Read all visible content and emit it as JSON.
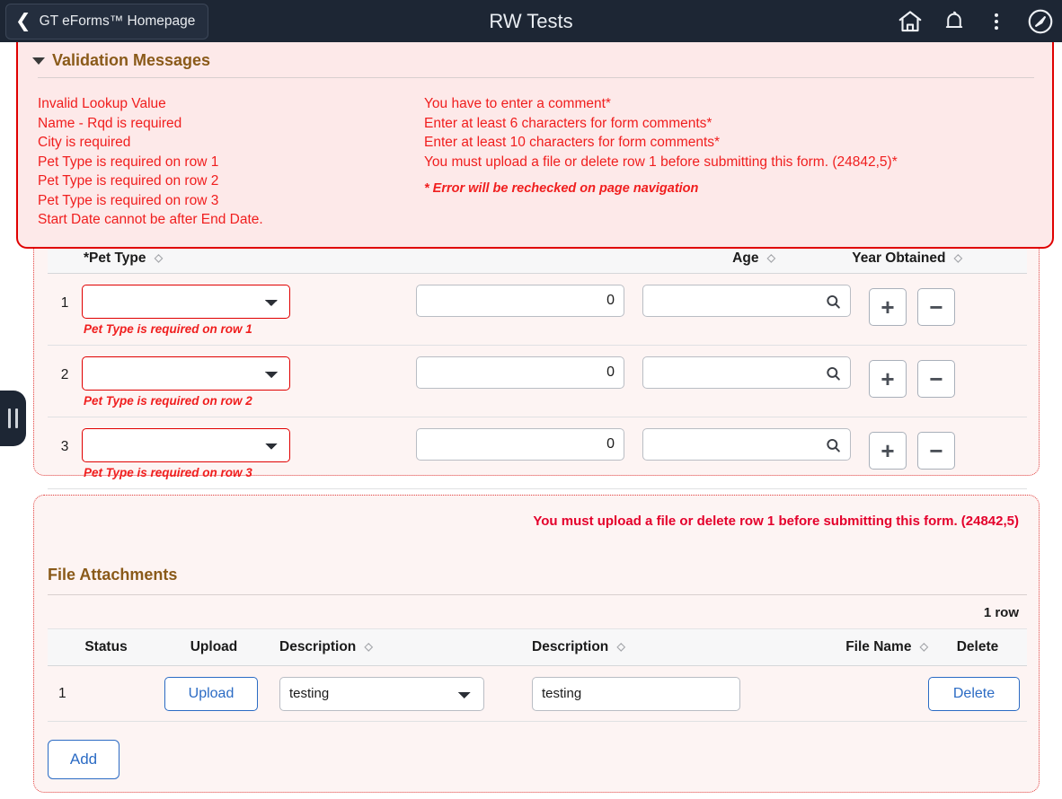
{
  "navbar": {
    "back_label": "GT eForms™ Homepage",
    "back_icon": "chevron-left-icon",
    "title": "RW Tests",
    "icons": [
      {
        "name": "home-icon",
        "label": "Home"
      },
      {
        "name": "bell-icon",
        "label": "Notifications"
      },
      {
        "name": "kebab-menu-icon",
        "label": "Actions"
      },
      {
        "name": "compass-icon",
        "label": "NavBar"
      }
    ],
    "bg_color": "#1d2634"
  },
  "side_handle": {
    "name": "panel-collapse-handle",
    "icon": "grip-bars-icon"
  },
  "validation_panel": {
    "title": "Validation Messages",
    "collapse_icon": "triangle-down-icon",
    "border_color": "#e00000",
    "bg_color": "#fde9e9",
    "text_color": "#f01e1e",
    "title_color": "#8a5a19",
    "left_messages": [
      "Invalid Lookup Value",
      "Name - Rqd is required",
      "City is required",
      "Pet Type is required on row 1",
      "Pet Type is required on row 2",
      "Pet Type is required on row 3",
      "Start Date cannot be after End Date."
    ],
    "right_messages": [
      "You have to enter a comment*",
      "Enter at least 6 characters for form comments*",
      "Enter at least 10 characters for form comments*",
      "You must upload a file or delete row 1 before submitting this form. (24842,5)*"
    ],
    "footnote": "* Error will be rechecked on page navigation"
  },
  "pet_grid": {
    "headers": [
      {
        "label": "*Pet Type",
        "sortable": true
      },
      {
        "label": "Age",
        "sortable": true
      },
      {
        "label": "Year Obtained",
        "sortable": true
      }
    ],
    "sort_icon": "sort-diamond-icon",
    "add_icon": "plus-icon",
    "remove_icon": "minus-icon",
    "search_icon": "search-icon",
    "rows": [
      {
        "num": "1",
        "pet_type": "",
        "pet_error": "Pet Type is required on row 1",
        "age": "0",
        "year_obtained": ""
      },
      {
        "num": "2",
        "pet_type": "",
        "pet_error": "Pet Type is required on row 2",
        "age": "0",
        "year_obtained": ""
      },
      {
        "num": "3",
        "pet_type": "",
        "pet_error": "Pet Type is required on row 3",
        "age": "0",
        "year_obtained": ""
      }
    ],
    "error_color": "#f01e1e"
  },
  "file_section": {
    "error": "You must upload a file or delete row 1 before submitting this form. (24842,5)",
    "title": "File Attachments",
    "row_count": "1 row",
    "headers": [
      {
        "label": "Status",
        "sortable": false
      },
      {
        "label": "Upload",
        "sortable": false
      },
      {
        "label": "Description",
        "sortable": true
      },
      {
        "label": "Description",
        "sortable": true
      },
      {
        "label": "File Name",
        "sortable": true
      },
      {
        "label": "Delete",
        "sortable": false
      }
    ],
    "rows": [
      {
        "num": "1",
        "upload_label": "Upload",
        "description_select": "testing",
        "description_text": "testing",
        "file_name": "",
        "delete_label": "Delete"
      }
    ],
    "add_label": "Add",
    "link_color": "#2b6bc4",
    "title_color": "#8a5a19",
    "error_color": "#e4002b"
  }
}
